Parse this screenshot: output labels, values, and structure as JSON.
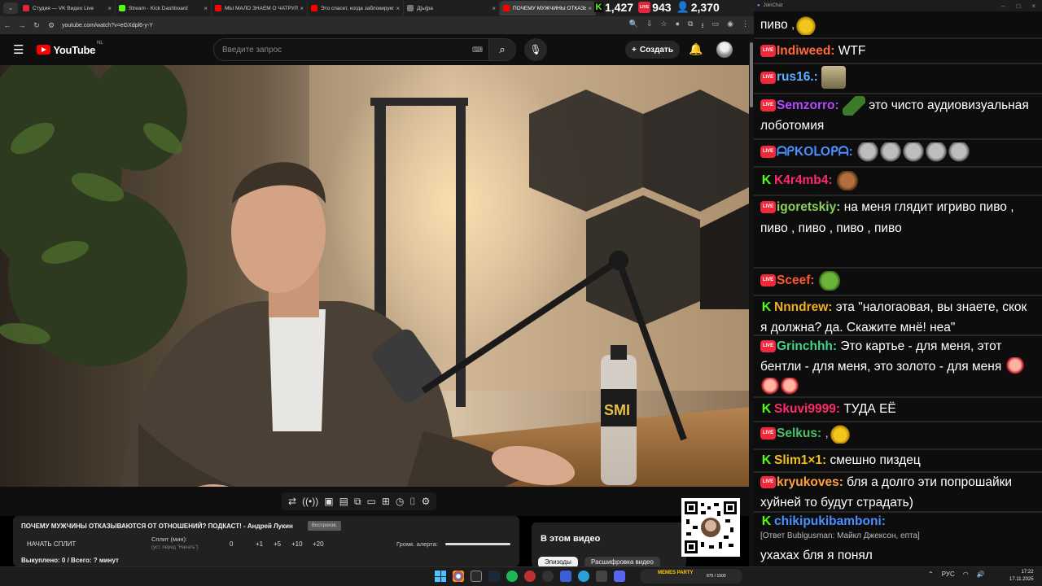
{
  "browser": {
    "tabs": [
      {
        "label": "Студия — VK Видео Live",
        "color": "#e5253b"
      },
      {
        "label": "Stream - Kick Dashboard",
        "color": "#53fc18"
      },
      {
        "label": "МЫ МАЛО ЗНАЕМ О ЧАТРУЛЕТКЕ",
        "color": "#ff0000"
      },
      {
        "label": "Это спасет, когда заблокируют",
        "color": "#ff0000"
      },
      {
        "label": "Д[ы]ра",
        "color": "#777777"
      },
      {
        "label": "ПОЧЕМУ МУЖЧИНЫ ОТКАЗЫ",
        "color": "#ff0000",
        "active": true
      }
    ],
    "url": "youtube.com/watch?v=eGXdpl6-y-Y"
  },
  "stream_stats": {
    "kick_viewers": "1,427",
    "vk_viewers": "943",
    "total_viewers": "2,370",
    "live_label": "LIVE",
    "kick_letter": "K"
  },
  "youtube": {
    "logo": "YouTube",
    "country": "NL",
    "search_placeholder": "Введите запрос",
    "create_label": "Создать",
    "icons": {
      "menu": "☰",
      "search": "⌕",
      "mic": "🎙",
      "bell": "🔔",
      "plus": "+",
      "keyboard": "⌨"
    }
  },
  "split_panel": {
    "title": "ПОЧЕМУ МУЖЧИНЫ ОТКАЗЫВАЮТСЯ ОТ ОТНОШЕНИЙ? ПОДКАСТ! - Андрей Лукин",
    "badge": "Воспроизв.",
    "start_label": "НАЧАТЬ СПЛИТ",
    "split_label": "Сплит (мин):",
    "split_hint": "(уст. перед \"Начать\")",
    "buttons": [
      "0",
      "+1",
      "+5",
      "+10",
      "+20"
    ],
    "alert_label": "Громк. алерта:",
    "paid_label": "Выкуплено: 0 / Всего: ? минут"
  },
  "in_this_video": {
    "title": "В этом видео",
    "tabs": [
      "Эпизоды",
      "Расшифровка видео"
    ]
  },
  "chat": {
    "window_title": "JoinChat",
    "messages": [
      {
        "platform": "",
        "user": "",
        "color": "#ffffff",
        "text": "пиво",
        "emotes": [
          "beer"
        ]
      },
      {
        "platform": "vk",
        "user": "Indiweed:",
        "color": "#ff6a3d",
        "text": "WTF"
      },
      {
        "platform": "vk",
        "user": "rus16.:",
        "color": "#5ab0ff",
        "text": "",
        "emotes": [
          "img"
        ]
      },
      {
        "platform": "vk",
        "user": "Semzorro:",
        "color": "#b14bff",
        "text": "это чисто аудиовизуальная лоботомия",
        "emotes": [
          "hat"
        ]
      },
      {
        "platform": "vk",
        "user": "ᗩᑭKOᒪOᑭᗩ:",
        "color": "#4a8fff",
        "text": "",
        "emotes": [
          "skull",
          "skull",
          "skull",
          "skull",
          "skull"
        ]
      },
      {
        "platform": "kick",
        "user": "K4r4mb4:",
        "color": "#ff2a6a",
        "text": "",
        "emotes": [
          "face"
        ]
      },
      {
        "platform": "vk",
        "user": "igoretskiy:",
        "color": "#8bd25a",
        "text": "на меня глядит игриво пиво , пиво , пиво , пиво , пиво"
      },
      {
        "platform": "vk",
        "user": "Sceef:",
        "color": "#ff5a2a",
        "text": "",
        "emotes": [
          "pepe"
        ]
      },
      {
        "platform": "kick",
        "user": "Nnndrew:",
        "color": "#f0b020",
        "text": "эта \"налогаовая, вы знаете, скок я должна? да. Скажите мнё! неа\""
      },
      {
        "platform": "vk",
        "user": "Grinchhh:",
        "color": "#3fd58a",
        "text": "Это картье - для меня, этот бентли - для меня, это золото - для меня",
        "emotes": [
          "char",
          "char",
          "char"
        ]
      },
      {
        "platform": "kick",
        "user": "Skuvi9999:",
        "color": "#ff2a6a",
        "text": "ТУДА ЕЁ"
      },
      {
        "platform": "vk",
        "user": "Selkus:",
        "color": "#4fbf6a",
        "text": ",",
        "emotes": [
          "beer"
        ]
      },
      {
        "platform": "kick",
        "user": "Slim1×1:",
        "color": "#f0c020",
        "text": "смешно пиздец"
      },
      {
        "platform": "vk",
        "user": "kryukoves:",
        "color": "#ffa23d",
        "text": "бля а долго эти попрошайки хуйней то будут страдать)"
      },
      {
        "platform": "kick",
        "user": "chikipukibamboni:",
        "color": "#4a8fff",
        "text": ""
      },
      {
        "platform": "",
        "user": "",
        "color": "#ffffff",
        "text": "[Ответ Bublgusman: Майкл Джексон, епта]"
      },
      {
        "platform": "",
        "user": "",
        "color": "#ffffff",
        "text": "ухахах бля я понял"
      }
    ]
  },
  "overlay": {
    "memes_title": "MEMES PARTY",
    "memes_count": "875 / 1500"
  },
  "taskbar": {
    "lang": "РУС",
    "time": "17:22",
    "date": "17.11.2025"
  }
}
